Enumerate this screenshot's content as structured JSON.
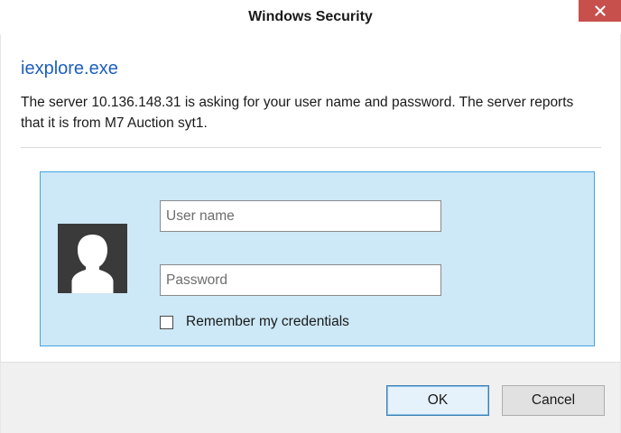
{
  "window": {
    "title": "Windows Security",
    "close_icon": "close-icon",
    "accent_close": "#c7504d"
  },
  "dialog": {
    "app_name": "iexplore.exe",
    "message": "The server 10.136.148.31 is asking for your user name and password. The server reports that it is from M7 Auction syt1.",
    "avatar_icon": "user-avatar-icon"
  },
  "credentials": {
    "username": {
      "value": "",
      "placeholder": "User name"
    },
    "password": {
      "value": "",
      "placeholder": "Password"
    },
    "remember_label": "Remember my credentials",
    "remember_checked": false,
    "panel_bg": "#cde8f6",
    "panel_border": "#45a5e0"
  },
  "buttons": {
    "ok": "OK",
    "cancel": "Cancel"
  }
}
